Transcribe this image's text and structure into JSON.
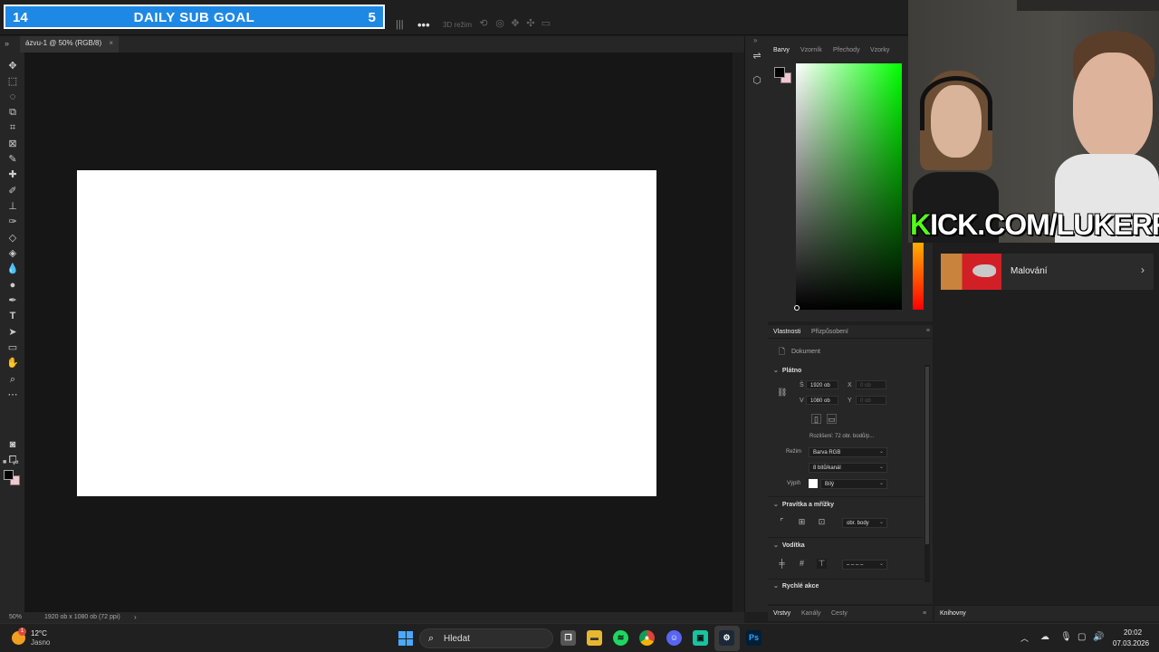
{
  "overlay": {
    "sub_goal_left": "14",
    "sub_goal_title": "DAILY SUB GOAL",
    "sub_goal_right": "5"
  },
  "options_bar": {
    "more": "•••",
    "mode_3d": "3D režim"
  },
  "document_tab": {
    "title": "ázvu-1 @ 50% (RGB/8)",
    "close": "×"
  },
  "status": {
    "zoom": "50%",
    "doc_info": "1920 ob x 1080 ob (72 ppi)",
    "arrow": "›"
  },
  "color_panel": {
    "tabs": [
      "Barvy",
      "Vzorník",
      "Přechody",
      "Vzorky"
    ],
    "foreground": "#000000",
    "background": "#f4c6cf",
    "hue": "#00ff00"
  },
  "properties": {
    "tabs": [
      "Vlastnosti",
      "Přizpůsobení"
    ],
    "doc_label": "Dokument",
    "canvas_section": "Plátno",
    "w_label": "Š",
    "w_value": "1920 ob",
    "x_label": "X",
    "x_value": "0 ob",
    "h_label": "V",
    "h_value": "1080 ob",
    "y_label": "Y",
    "y_value": "0 ob",
    "resolution": "Rozlišení: 72 obr. bodů/p...",
    "mode_label": "Režim",
    "mode_value": "Barva RGB",
    "depth_value": "8 bitů/kanál",
    "fill_label": "Výplň",
    "fill_value": "Bílý",
    "rulers_section": "Pravítka a mřížky",
    "units_value": "obr. body",
    "guides_section": "Vodítka",
    "guides_value": "– – – –",
    "quick_section": "Rychlé akce"
  },
  "layers_tabs": [
    "Vrstvy",
    "Kanály",
    "Cesty"
  ],
  "libraries": {
    "tab": "Knihovny",
    "item_label": "Malování"
  },
  "stream": {
    "kick_k": "K",
    "kick_rest": "ICK.COM/LUKERRIS"
  },
  "taskbar": {
    "temp": "12°C",
    "weather": "Jasno",
    "weather_badge": "1",
    "search_placeholder": "Hledat",
    "time": "20:02",
    "date": "07.03.2026",
    "ps_label": "Ps"
  }
}
